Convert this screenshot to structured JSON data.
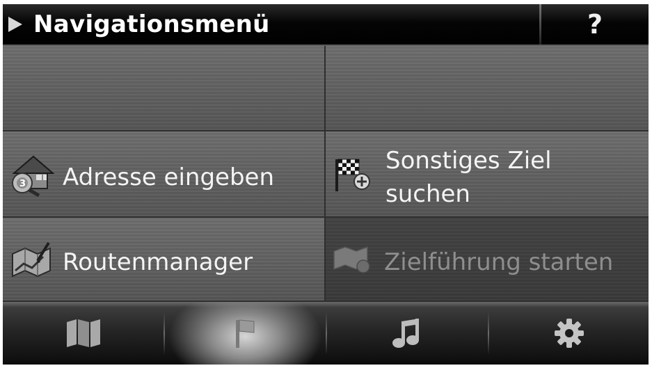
{
  "header": {
    "title": "Navigationsmenü",
    "help_label": "?"
  },
  "menu": {
    "items": [
      {
        "label": "",
        "icon": ""
      },
      {
        "label": "",
        "icon": ""
      },
      {
        "label": "Adresse eingeben",
        "icon": "house-address-icon"
      },
      {
        "label_line1": "Sonstiges Ziel",
        "label_line2": "suchen",
        "icon": "checkered-flag-plus-icon"
      },
      {
        "label": "Routenmanager",
        "icon": "route-map-icon"
      },
      {
        "label": "Zielführung starten",
        "icon": "map-start-icon",
        "state": "disabled"
      }
    ]
  },
  "bottom_nav": {
    "items": [
      {
        "icon": "map-icon"
      },
      {
        "icon": "flag-icon",
        "state": "active"
      },
      {
        "icon": "music-note-icon"
      },
      {
        "icon": "gear-icon"
      }
    ]
  },
  "colors": {
    "title_text": "#ffffff",
    "tile_text": "#f4f4f4",
    "disabled_text": "#8e8e8e"
  }
}
